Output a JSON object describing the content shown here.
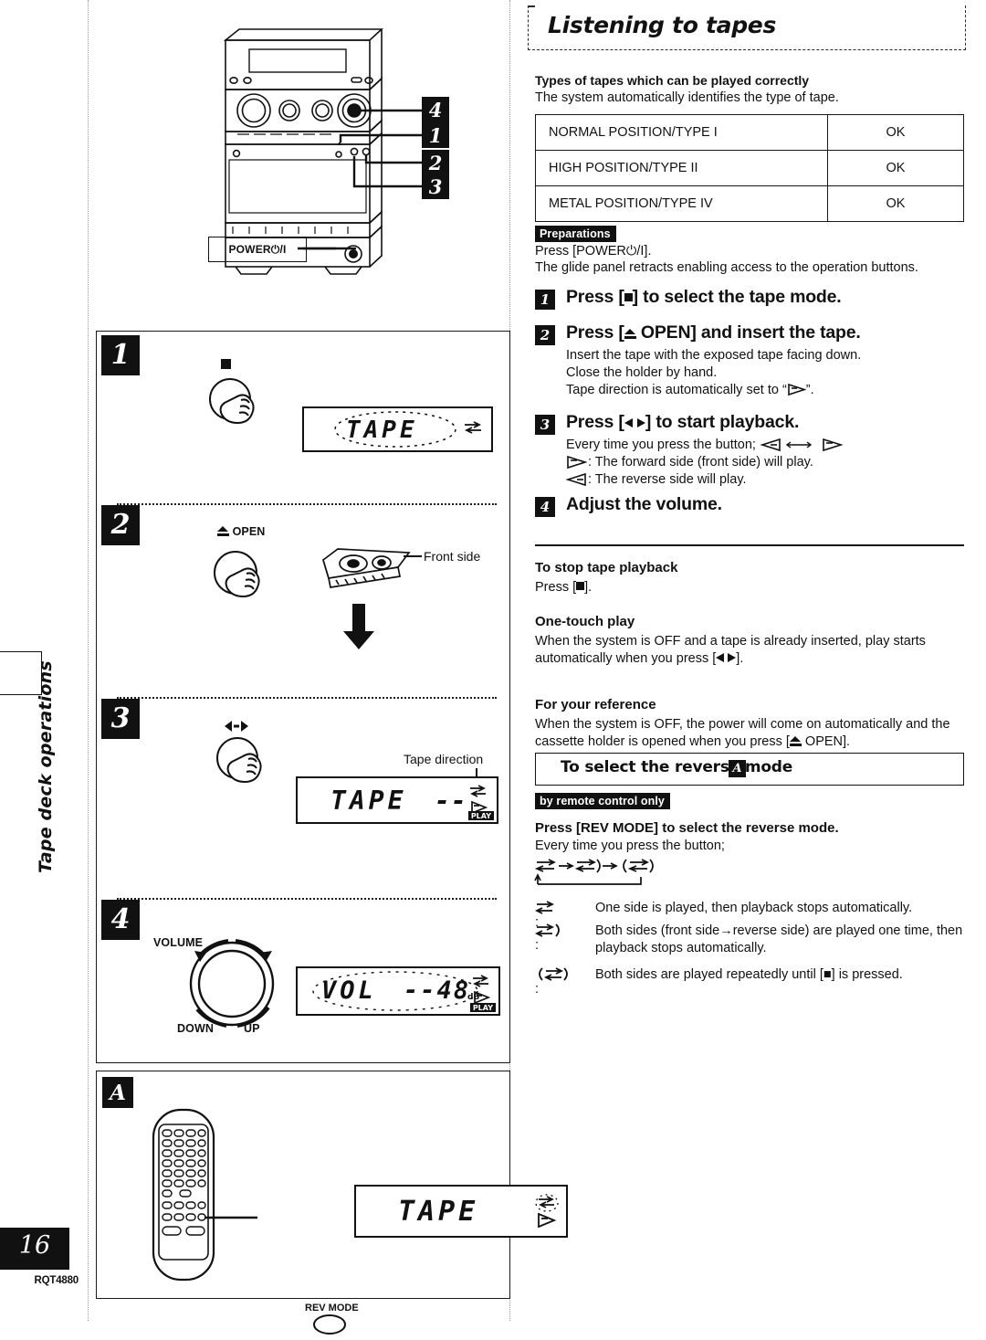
{
  "sidebar": {
    "tab_label": "Tape deck operations",
    "page_number": "16",
    "model_code": "RQT4880"
  },
  "machine_figure": {
    "power_label": "POWER⏻/I",
    "callouts": [
      "4",
      "1",
      "2",
      "3"
    ]
  },
  "title": "Listening to tapes",
  "tapes_section": {
    "heading": "Types of tapes which can be played correctly",
    "intro": "The system automatically identifies the type of tape.",
    "table": {
      "rows": [
        {
          "type": "NORMAL POSITION/TYPE I",
          "status": "OK"
        },
        {
          "type": "HIGH POSITION/TYPE II",
          "status": "OK"
        },
        {
          "type": "METAL POSITION/TYPE IV",
          "status": "OK"
        }
      ]
    }
  },
  "preparations": {
    "tag": "Preparations",
    "line1": "Press [POWER⏻/I].",
    "line2": "The glide panel retracts enabling access to the operation buttons."
  },
  "steps": [
    {
      "num": "1",
      "title_pre": "Press [",
      "title_post": "] to select the tape mode.",
      "body": []
    },
    {
      "num": "2",
      "title_pre": "Press [",
      "title_post": " OPEN] and insert the tape.",
      "body": [
        "Insert the tape with the exposed tape facing down.",
        "Close the holder by hand.",
        "Tape direction is automatically set to “▷”."
      ]
    },
    {
      "num": "3",
      "title_pre": "Press [",
      "title_post": "] to start playback.",
      "body": [
        "Every time you press the button;",
        ": The forward side (front side) will play.",
        ": The reverse side will play."
      ]
    },
    {
      "num": "4",
      "title_pre": "Adjust the volume.",
      "title_post": "",
      "body": []
    }
  ],
  "notes": [
    {
      "heading": "To stop tape playback",
      "body": "Press [■]."
    },
    {
      "heading": "One-touch play",
      "body": "When the system is OFF and a tape is already inserted, play starts automatically when you press [◀ ▶]."
    },
    {
      "heading": "For your reference",
      "body": "When the system is OFF, the power will come on automatically and the cassette holder is opened when you press [▲ OPEN]."
    }
  ],
  "reverse_mode": {
    "box_title": "To select the reverse mode",
    "box_letter": "A",
    "remote_tag": "by remote control only",
    "press_heading": "Press [REV MODE] to select the reverse mode.",
    "press_body": "Every time you press the button;",
    "items": [
      {
        "glyph": "one-side",
        "text": "One side is played, then playback stops automatically."
      },
      {
        "glyph": "both-once",
        "text": "Both sides (front side→reverse side) are played one time, then playback stops automatically."
      },
      {
        "glyph": "both-repeat",
        "text": "Both sides are played repeatedly until [■] is pressed."
      }
    ]
  },
  "panels": {
    "step1": {
      "badge": "1",
      "display_text": "TAPE"
    },
    "step2": {
      "badge": "2",
      "open_label": "OPEN",
      "cassette_label": "Front side"
    },
    "step3": {
      "badge": "3",
      "display_text": "TAPE",
      "display_dashes": "--",
      "direction_label": "Tape direction",
      "play_badge": "PLAY"
    },
    "step4": {
      "badge": "4",
      "volume_label": "VOLUME",
      "down_label": "DOWN",
      "up_label": "UP",
      "display_text": "VOL",
      "display_value": "--48",
      "display_unit": "dB",
      "play_badge": "PLAY"
    },
    "panel_a": {
      "badge": "A",
      "rev_mode_label": "REV MODE",
      "display_text": "TAPE"
    }
  }
}
